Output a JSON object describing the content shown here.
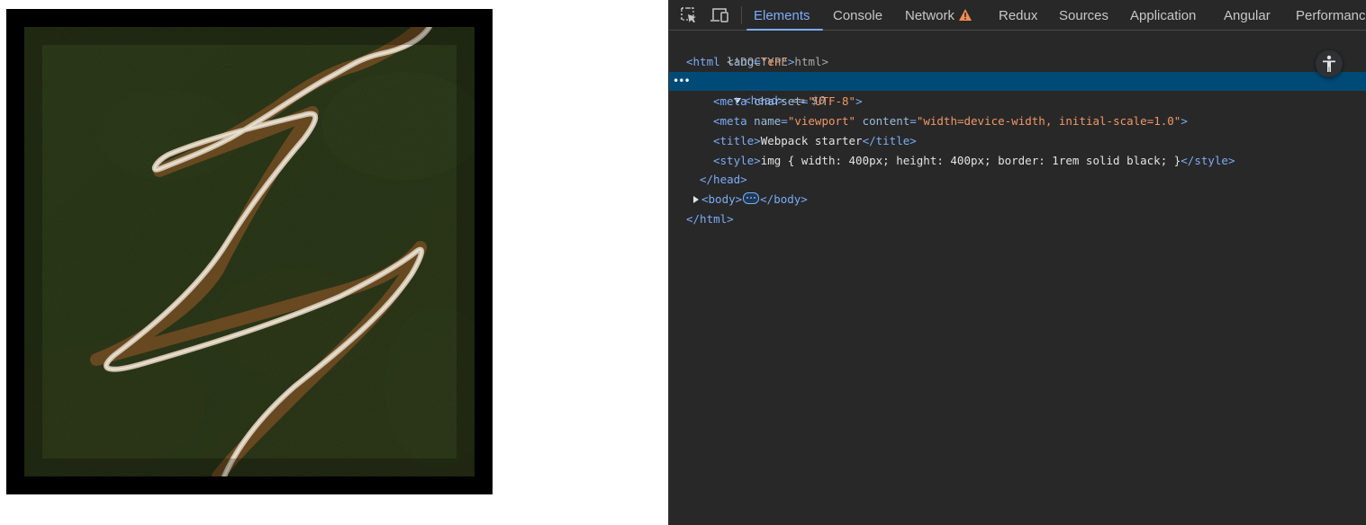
{
  "devtools": {
    "tabs": [
      {
        "label": "Elements",
        "active": true
      },
      {
        "label": "Console"
      },
      {
        "label": "Network",
        "icon": "warning-icon"
      },
      {
        "label": "Redux"
      },
      {
        "label": "Sources"
      },
      {
        "label": "Application"
      },
      {
        "label": "Angular"
      },
      {
        "label": "Performance"
      }
    ],
    "icons": {
      "inspect": "inspect-element-icon",
      "device": "device-toolbar-icon",
      "accessibility": "accessibility-icon"
    },
    "colors": {
      "accent": "#7cacf8",
      "selected_row": "#004a77",
      "warning": "#f28b54",
      "attr_value": "#f29766"
    },
    "tree": {
      "doctype": "<!DOCTYPE html>",
      "html_open": {
        "tag": "<html",
        "attr": "lang",
        "value": "\"en\"",
        "close": ">"
      },
      "head_open": "<head>",
      "selected_marker": "== $0",
      "meta_charset": {
        "tag": "<meta",
        "attr": "charset",
        "value": "\"UTF-8\"",
        "close": ">"
      },
      "meta_viewport": {
        "tag": "<meta",
        "attr1": "name",
        "value1": "\"viewport\"",
        "attr2": "content",
        "value2": "\"width=device-width, initial-scale=1.0\"",
        "close": ">"
      },
      "title": {
        "open": "<title>",
        "text": "Webpack starter",
        "close": "</title>"
      },
      "style": {
        "open": "<style>",
        "text": "img { width: 400px; height: 400px; border: 1rem solid black; }",
        "close": "</style>"
      },
      "head_close": "</head>",
      "body": {
        "open": "<body>",
        "close": "</body>"
      },
      "html_close": "</html>"
    }
  }
}
